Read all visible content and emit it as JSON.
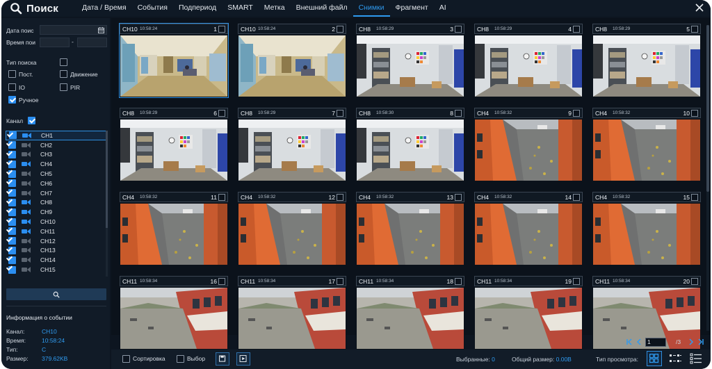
{
  "header": {
    "title": "Поиск",
    "tabs": [
      "Дата / Время",
      "События",
      "Подпериод",
      "SMART",
      "Метка",
      "Внешний файл",
      "Снимки",
      "Фрагмент",
      "AI"
    ],
    "active_tab": "Снимки"
  },
  "sidebar": {
    "date_label": "Дата поис",
    "time_label": "Время пои",
    "time_separator": "-",
    "search_type_label": "Тип поиска",
    "types": [
      {
        "label": "Пост.",
        "checked": false
      },
      {
        "label": "Движение",
        "checked": false
      },
      {
        "label": "IO",
        "checked": false
      },
      {
        "label": "PIR",
        "checked": false
      },
      {
        "label": "Ручное",
        "checked": true
      }
    ],
    "channel_label": "Канал",
    "channels": [
      "CH1",
      "CH2",
      "CH3",
      "CH4",
      "CH5",
      "CH6",
      "CH7",
      "CH8",
      "CH9",
      "CH10",
      "CH11",
      "CH12",
      "CH13",
      "CH14",
      "CH15"
    ],
    "active_channels": [
      "CH1",
      "CH4",
      "CH8",
      "CH9",
      "CH10",
      "CH11"
    ],
    "selected_channel": "CH1",
    "event_info": {
      "title": "Информация о событии",
      "channel_label": "Канал:",
      "channel_value": "CH10",
      "time_label": "Время:",
      "time_value": "10:58:24",
      "type_label": "Тип:",
      "type_value": "C",
      "size_label": "Размер:",
      "size_value": "379.62KB"
    }
  },
  "snapshots": [
    {
      "ch": "CH10",
      "time": "10:58:24",
      "num": "1",
      "scene": "shop"
    },
    {
      "ch": "CH10",
      "time": "10:58:24",
      "num": "2",
      "scene": "shop"
    },
    {
      "ch": "CH8",
      "time": "10:58:29",
      "num": "3",
      "scene": "office"
    },
    {
      "ch": "CH8",
      "time": "10:58:29",
      "num": "4",
      "scene": "office"
    },
    {
      "ch": "CH8",
      "time": "10:58:29",
      "num": "5",
      "scene": "office"
    },
    {
      "ch": "CH8",
      "time": "10:58:29",
      "num": "6",
      "scene": "office"
    },
    {
      "ch": "CH8",
      "time": "10:58:29",
      "num": "7",
      "scene": "office"
    },
    {
      "ch": "CH8",
      "time": "10:58:30",
      "num": "8",
      "scene": "office"
    },
    {
      "ch": "CH4",
      "time": "10:58:32",
      "num": "9",
      "scene": "yard"
    },
    {
      "ch": "CH4",
      "time": "10:58:32",
      "num": "10",
      "scene": "yard"
    },
    {
      "ch": "CH4",
      "time": "10:58:32",
      "num": "11",
      "scene": "yard"
    },
    {
      "ch": "CH4",
      "time": "10:58:32",
      "num": "12",
      "scene": "yard"
    },
    {
      "ch": "CH4",
      "time": "10:58:32",
      "num": "13",
      "scene": "yard"
    },
    {
      "ch": "CH4",
      "time": "10:58:32",
      "num": "14",
      "scene": "yard"
    },
    {
      "ch": "CH4",
      "time": "10:58:32",
      "num": "15",
      "scene": "yard"
    },
    {
      "ch": "CH11",
      "time": "10:58:34",
      "num": "16",
      "scene": "street"
    },
    {
      "ch": "CH11",
      "time": "10:58:34",
      "num": "17",
      "scene": "street"
    },
    {
      "ch": "CH11",
      "time": "10:58:34",
      "num": "18",
      "scene": "street"
    },
    {
      "ch": "CH11",
      "time": "10:58:34",
      "num": "19",
      "scene": "street"
    },
    {
      "ch": "CH11",
      "time": "10:58:34",
      "num": "20",
      "scene": "street"
    }
  ],
  "pager": {
    "current_page": "1",
    "total": "/3"
  },
  "bottombar": {
    "sort_label": "Сортировка",
    "select_label": "Выбор",
    "selected_label": "Выбранные:",
    "selected_value": "0",
    "total_size_label": "Общий размер:",
    "total_size_value": "0.00B",
    "view_type_label": "Тип просмотра:"
  },
  "colors": {
    "accent": "#2f9bf0",
    "background": "#0d1520",
    "active_cam": "#2b8ef0",
    "inactive_cam": "#5a6470"
  }
}
